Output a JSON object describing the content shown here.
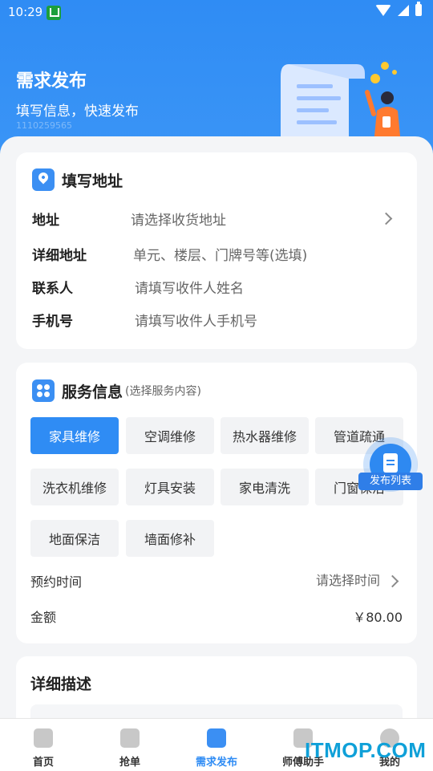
{
  "status_bar": {
    "time": "10:29"
  },
  "header": {
    "title": "需求发布",
    "subtitle": "填写信息，快速发布",
    "code": "1110259565"
  },
  "address_card": {
    "title": "填写地址",
    "rows": [
      {
        "label": "地址",
        "value": "请选择收货地址"
      },
      {
        "label": "详细地址",
        "value": "单元、楼层、门牌号等(选填)"
      },
      {
        "label": "联系人",
        "value": "请填写收件人姓名"
      },
      {
        "label": "手机号",
        "value": "请填写收件人手机号"
      }
    ]
  },
  "service_card": {
    "title": "服务信息",
    "hint": "(选择服务内容)",
    "services": [
      "家具维修",
      "空调维修",
      "热水器维修",
      "管道疏通",
      "洗衣机维修",
      "灯具安装",
      "家电清洗",
      "门窗保洁",
      "地面保洁",
      "墙面修补"
    ],
    "selected": "家具维修",
    "time_label": "预约时间",
    "time_value": "请选择时间",
    "amount_label": "金额",
    "amount_value": "￥80.00"
  },
  "fab": {
    "label": "发布列表"
  },
  "desc_card": {
    "title": "详细描述"
  },
  "tabs": [
    {
      "label": "首页",
      "icon": "home-icon",
      "active": false
    },
    {
      "label": "抢单",
      "icon": "order-icon",
      "active": false
    },
    {
      "label": "需求发布",
      "icon": "publish-icon",
      "active": true
    },
    {
      "label": "师傅助手",
      "icon": "toolbox-icon",
      "active": false
    },
    {
      "label": "我的",
      "icon": "profile-icon",
      "active": false
    }
  ],
  "watermark": "ITMOP.COM",
  "colors": {
    "primary": "#2f8cf4",
    "chip_bg": "#f2f3f5",
    "background": "#f4f5f7"
  }
}
